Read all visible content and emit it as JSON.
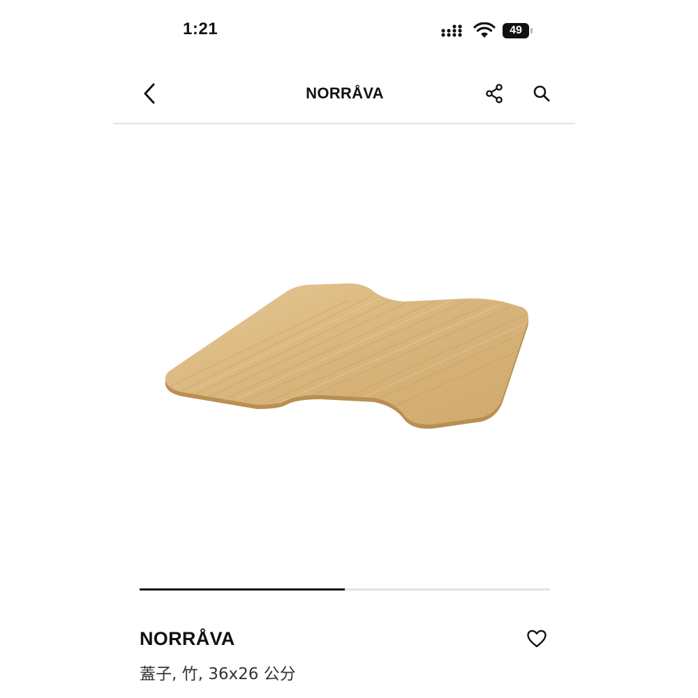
{
  "status_bar": {
    "time": "1:21",
    "battery_level": "49",
    "signal_icon": "cellular-signal-icon",
    "wifi_icon": "wifi-icon"
  },
  "header": {
    "title": "NORRÅVA",
    "back_icon": "chevron-left-icon",
    "share_icon": "share-icon",
    "search_icon": "search-icon"
  },
  "gallery": {
    "image_subject": "bamboo cover board",
    "progress_fraction": 0.5
  },
  "product": {
    "name": "NORRÅVA",
    "description": "蓋子, 竹, 36x26 公分",
    "favorite_icon": "heart-outline-icon"
  },
  "colors": {
    "text": "#111111",
    "divider": "#e3e3e3",
    "progress_track": "#e2e2e2",
    "progress_fill": "#111111",
    "wood": "#d8b57c"
  }
}
